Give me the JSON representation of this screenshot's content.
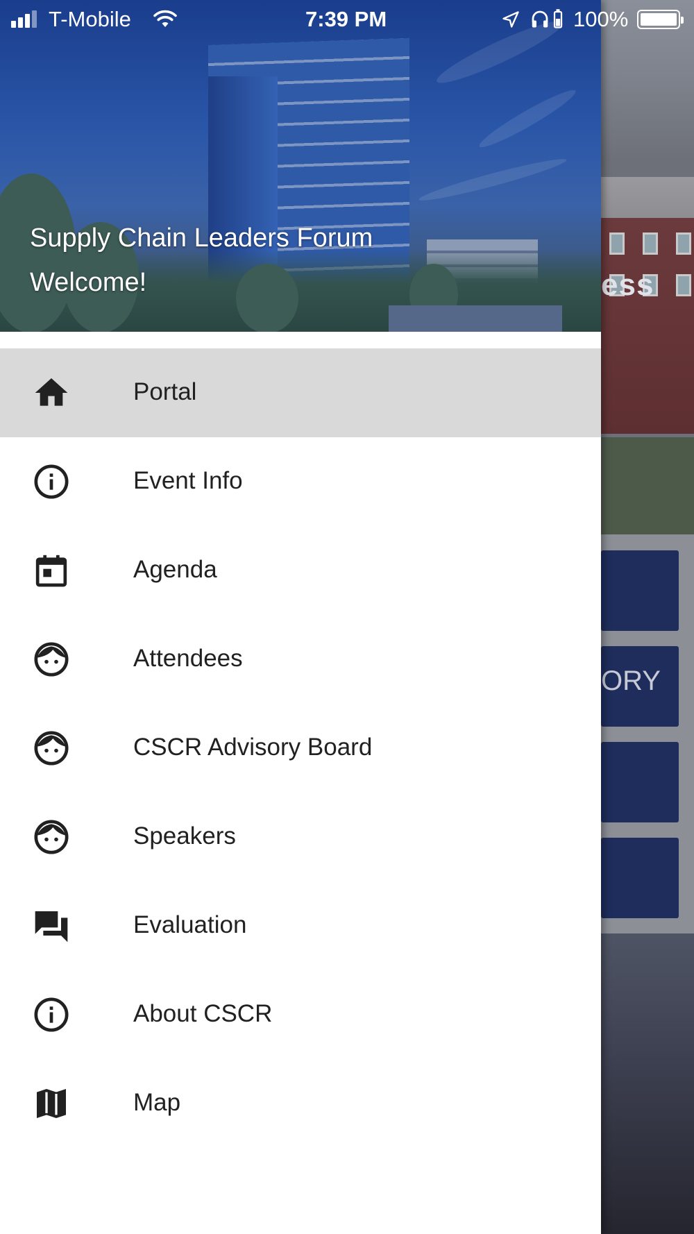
{
  "status_bar": {
    "carrier": "T-Mobile",
    "time": "7:39 PM",
    "battery_percent": "100%"
  },
  "drawer": {
    "title": "Supply Chain Leaders Forum",
    "subtitle": "Welcome!",
    "items": [
      {
        "label": "Portal",
        "icon": "home-icon",
        "active": true
      },
      {
        "label": "Event Info",
        "icon": "info-icon"
      },
      {
        "label": "Agenda",
        "icon": "calendar-icon"
      },
      {
        "label": "Attendees",
        "icon": "face-icon"
      },
      {
        "label": "CSCR Advisory Board",
        "icon": "face-icon"
      },
      {
        "label": "Speakers",
        "icon": "face-icon"
      },
      {
        "label": "Evaluation",
        "icon": "forum-icon"
      },
      {
        "label": "About CSCR",
        "icon": "info-icon"
      },
      {
        "label": "Map",
        "icon": "map-icon"
      }
    ],
    "accent_color": "#d9d9d9"
  },
  "background": {
    "hero_text": "ess",
    "tile_text": "ORY"
  }
}
